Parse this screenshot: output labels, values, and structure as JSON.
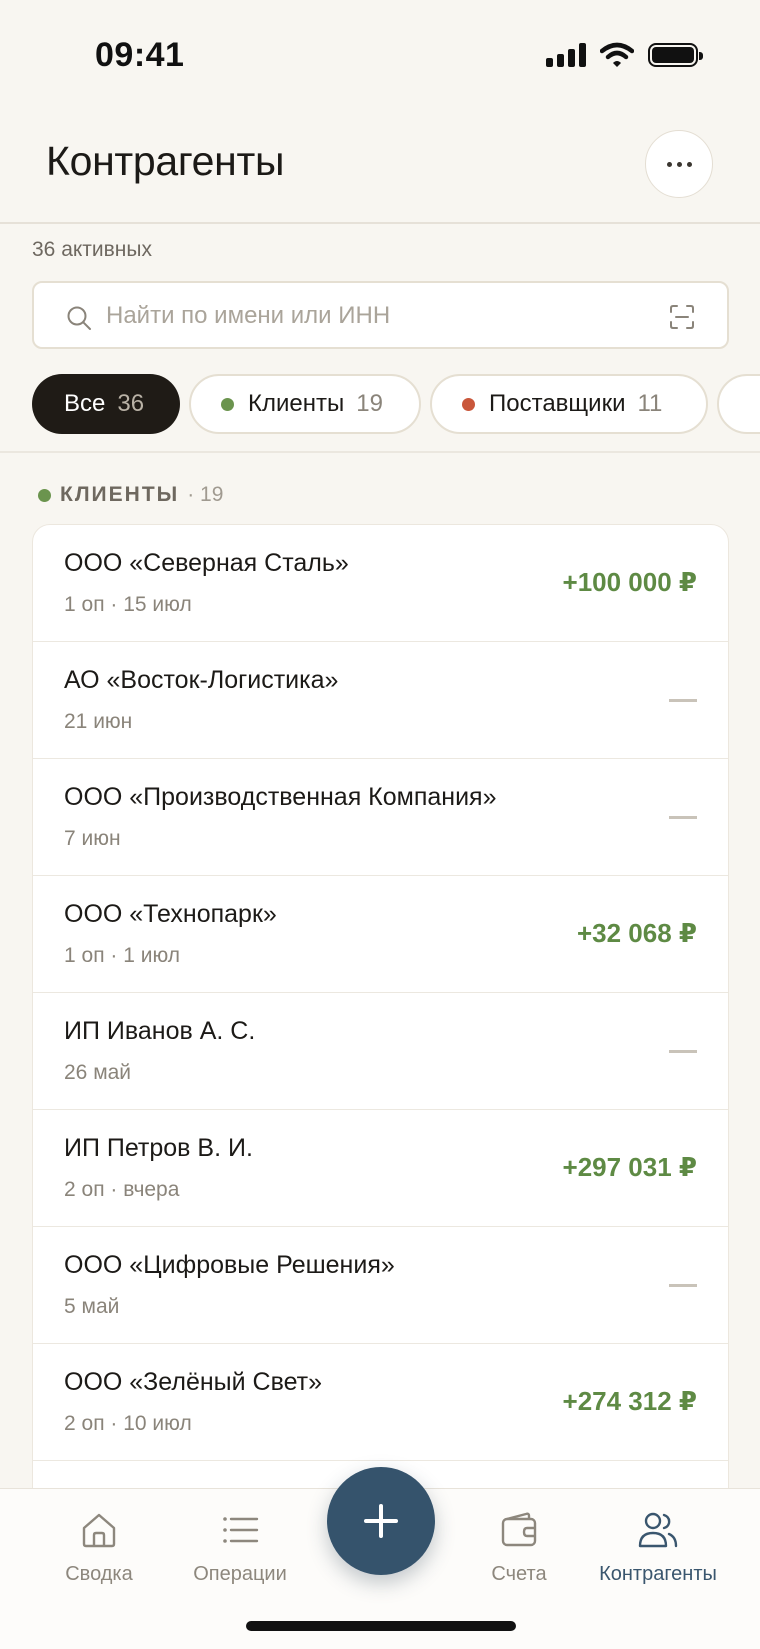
{
  "status_bar": {
    "time": "09:41"
  },
  "header": {
    "title": "Контрагенты"
  },
  "summary": {
    "active_count": "36 активных"
  },
  "search": {
    "placeholder": "Найти по имени или ИНН"
  },
  "filters": [
    {
      "label": "Все",
      "count": "36",
      "selected": true
    },
    {
      "label": "Клиенты",
      "count": "19",
      "dot_color": "#6b944e"
    },
    {
      "label": "Поставщики",
      "count": "11",
      "dot_color": "#c9573b"
    }
  ],
  "section": {
    "title": "КЛИЕНТЫ",
    "count": "· 19",
    "dot_color": "#6b944e"
  },
  "clients": [
    {
      "name": "ООО «Северная Сталь»",
      "meta": "1 оп · 15 июл",
      "amount": "+100 000 ₽"
    },
    {
      "name": "АО «Восток-Логистика»",
      "meta": "21 июн",
      "amount": null
    },
    {
      "name": "ООО «Производственная Компания»",
      "meta": "7 июн",
      "amount": null
    },
    {
      "name": "ООО «Технопарк»",
      "meta": "1 оп · 1 июл",
      "amount": "+32 068 ₽"
    },
    {
      "name": "ИП Иванов А. С.",
      "meta": "26 май",
      "amount": null
    },
    {
      "name": "ИП Петров В. И.",
      "meta": "2 оп · вчера",
      "amount": "+297 031 ₽"
    },
    {
      "name": "ООО «Цифровые Решения»",
      "meta": "5 май",
      "amount": null
    },
    {
      "name": "ООО «Зелёный Свет»",
      "meta": "2 оп · 10 июл",
      "amount": "+274 312 ₽"
    }
  ],
  "tab_bar": {
    "items": [
      {
        "label": "Сводка",
        "icon": "home-icon"
      },
      {
        "label": "Операции",
        "icon": "list-icon"
      },
      {
        "label": "Счета",
        "icon": "wallet-icon"
      },
      {
        "label": "Контрагенты",
        "icon": "people-icon",
        "active": true
      }
    ],
    "fab_icon": "plus-icon"
  },
  "colors": {
    "accent": "#35536c",
    "positive": "#5e8a44",
    "background": "#f8f6f1"
  }
}
